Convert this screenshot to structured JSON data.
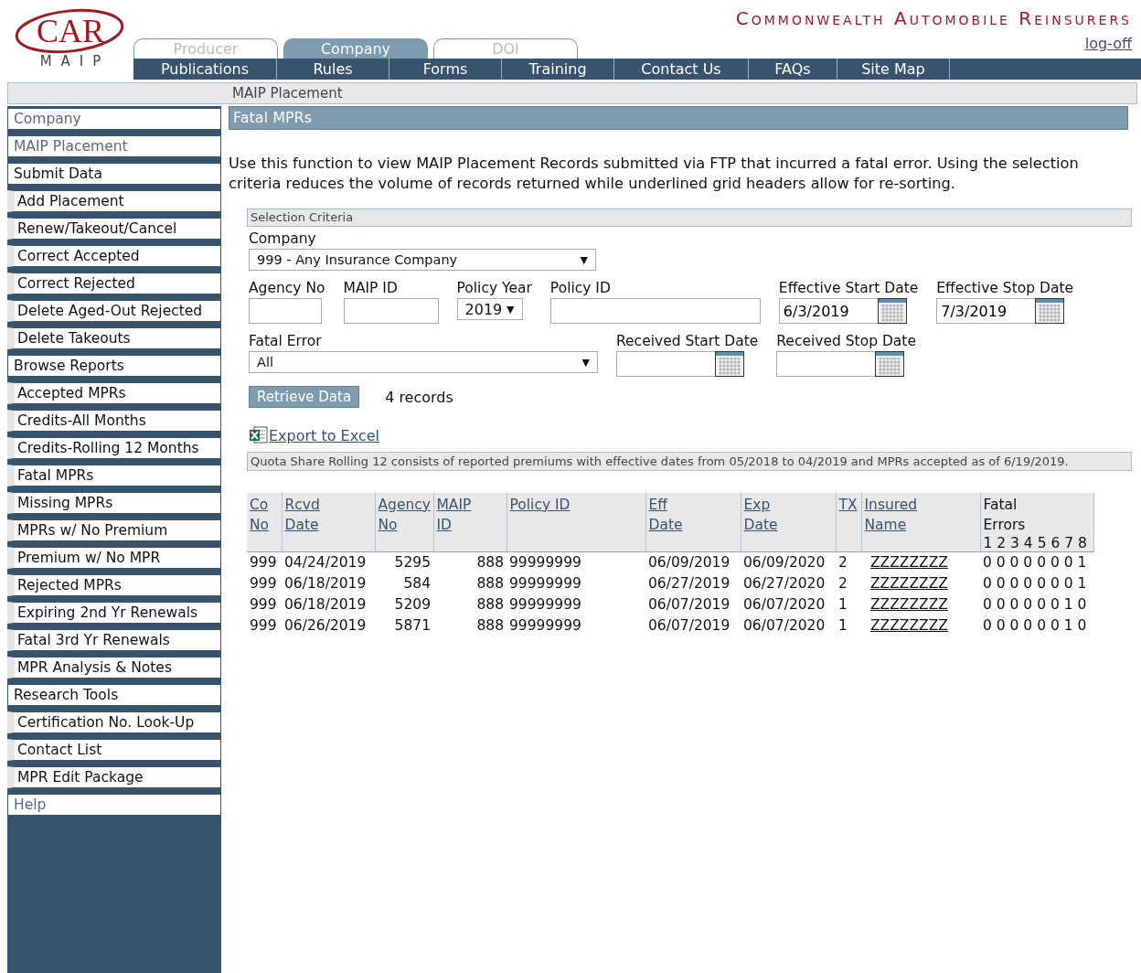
{
  "logo": {
    "name": "CAR",
    "sub": "MAIP"
  },
  "org_title": "Commonwealth Automobile Reinsurers",
  "logoff": "log-off",
  "tabs": [
    {
      "label": "Producer",
      "selected": false
    },
    {
      "label": "Company",
      "selected": true
    },
    {
      "label": "DOI",
      "selected": false
    }
  ],
  "nav": [
    "Publications",
    "Rules",
    "Forms",
    "Training",
    "Contact Us",
    "FAQs",
    "Site Map"
  ],
  "breadcrumb": "MAIP Placement",
  "sidebar": {
    "items": [
      {
        "label": "Company",
        "kind": "header",
        "dimmed": true
      },
      {
        "label": "MAIP Placement",
        "kind": "header",
        "dimmed": true
      },
      {
        "label": "Submit Data",
        "kind": "header",
        "dimmed": false
      },
      {
        "label": "Add Placement",
        "kind": "link"
      },
      {
        "label": "Renew/Takeout/Cancel",
        "kind": "link"
      },
      {
        "label": "Correct Accepted",
        "kind": "link"
      },
      {
        "label": "Correct Rejected",
        "kind": "link"
      },
      {
        "label": "Delete Aged-Out Rejected",
        "kind": "link"
      },
      {
        "label": "Delete Takeouts",
        "kind": "link"
      },
      {
        "label": "Browse Reports",
        "kind": "header",
        "dimmed": false
      },
      {
        "label": "Accepted MPRs",
        "kind": "link"
      },
      {
        "label": "Credits-All Months",
        "kind": "link"
      },
      {
        "label": "Credits-Rolling 12 Months",
        "kind": "link"
      },
      {
        "label": "Fatal MPRs",
        "kind": "link"
      },
      {
        "label": "Missing MPRs",
        "kind": "link"
      },
      {
        "label": "MPRs w/ No Premium",
        "kind": "link"
      },
      {
        "label": "Premium w/ No MPR",
        "kind": "link"
      },
      {
        "label": "Rejected MPRs",
        "kind": "link"
      },
      {
        "label": "Expiring 2nd Yr Renewals",
        "kind": "link"
      },
      {
        "label": "Fatal 3rd Yr Renewals",
        "kind": "link"
      },
      {
        "label": "MPR Analysis & Notes",
        "kind": "link"
      },
      {
        "label": "Research Tools",
        "kind": "header",
        "dimmed": false
      },
      {
        "label": "Certification No. Look-Up",
        "kind": "link"
      },
      {
        "label": "Contact List",
        "kind": "link"
      },
      {
        "label": "MPR Edit Package",
        "kind": "link"
      },
      {
        "label": "Help",
        "kind": "header",
        "dimmed": true
      }
    ]
  },
  "panel_title": "Fatal MPRs",
  "description": "Use this function to view MAIP Placement Records submitted via FTP that incurred a fatal error.  Using the selection criteria reduces the volume of records returned while underlined grid headers allow for re-sorting.",
  "criteria": {
    "title": "Selection Criteria",
    "company": {
      "label": "Company",
      "value": "999 - Any Insurance Company",
      "caret": "▼"
    },
    "agency_no": {
      "label": "Agency No"
    },
    "maip_id": {
      "label": "MAIP ID"
    },
    "policy_year": {
      "label": "Policy Year",
      "value": "2019",
      "caret": "▼"
    },
    "policy_id": {
      "label": "Policy ID"
    },
    "effective_start": {
      "label": "Effective Start Date",
      "value": "6/3/2019"
    },
    "effective_stop": {
      "label": "Effective Stop Date",
      "value": "7/3/2019"
    },
    "fatal_error": {
      "label": "Fatal Error",
      "value": "All",
      "caret": "▼"
    },
    "received_start": {
      "label": "Received Start Date"
    },
    "received_stop": {
      "label": "Received Stop Date"
    },
    "retrieve_button": "Retrieve Data",
    "record_count": "4 records"
  },
  "export_link": "Export to Excel",
  "note": "Quota Share Rolling 12 consists of reported premiums with effective dates from 05/2018 to 04/2019 and MPRs accepted as of 6/19/2019.",
  "table": {
    "columns": [
      {
        "lines": [
          "Co",
          "No"
        ],
        "kind": "text",
        "sortable": true
      },
      {
        "lines": [
          "Rcvd",
          "Date"
        ],
        "kind": "text",
        "sortable": true
      },
      {
        "lines": [
          "Agency",
          "No"
        ],
        "kind": "number",
        "sortable": true
      },
      {
        "lines": [
          "MAIP",
          "ID"
        ],
        "kind": "number",
        "sortable": true
      },
      {
        "lines": [
          "Policy ID"
        ],
        "kind": "text",
        "sortable": true
      },
      {
        "lines": [
          "Eff",
          "Date"
        ],
        "kind": "text",
        "sortable": true
      },
      {
        "lines": [
          "Exp",
          "Date"
        ],
        "kind": "text",
        "sortable": true
      },
      {
        "lines": [
          "TX"
        ],
        "kind": "text",
        "sortable": true
      },
      {
        "lines": [
          "Insured",
          "Name"
        ],
        "kind": "link",
        "sortable": true
      },
      {
        "lines": [
          "Fatal",
          "Errors",
          "1 2 3 4 5 6 7 8"
        ],
        "kind": "text",
        "sortable": false
      }
    ],
    "rows": [
      [
        "999",
        "04/24/2019",
        "5295",
        "888",
        "99999999",
        "06/09/2019",
        "06/09/2020",
        "2",
        "ZZZZZZZZ",
        "0 0 0 0 0 0 0 1"
      ],
      [
        "999",
        "06/18/2019",
        "584",
        "888",
        "99999999",
        "06/27/2019",
        "06/27/2020",
        "2",
        "ZZZZZZZZ",
        "0 0 0 0 0 0 0 1"
      ],
      [
        "999",
        "06/18/2019",
        "5209",
        "888",
        "99999999",
        "06/07/2019",
        "06/07/2020",
        "1",
        "ZZZZZZZZ",
        "0 0 0 0 0 0 1 0"
      ],
      [
        "999",
        "06/26/2019",
        "5871",
        "888",
        "99999999",
        "06/07/2019",
        "06/07/2020",
        "1",
        "ZZZZZZZZ",
        "0 0 0 0 0 0 1 0"
      ]
    ]
  }
}
